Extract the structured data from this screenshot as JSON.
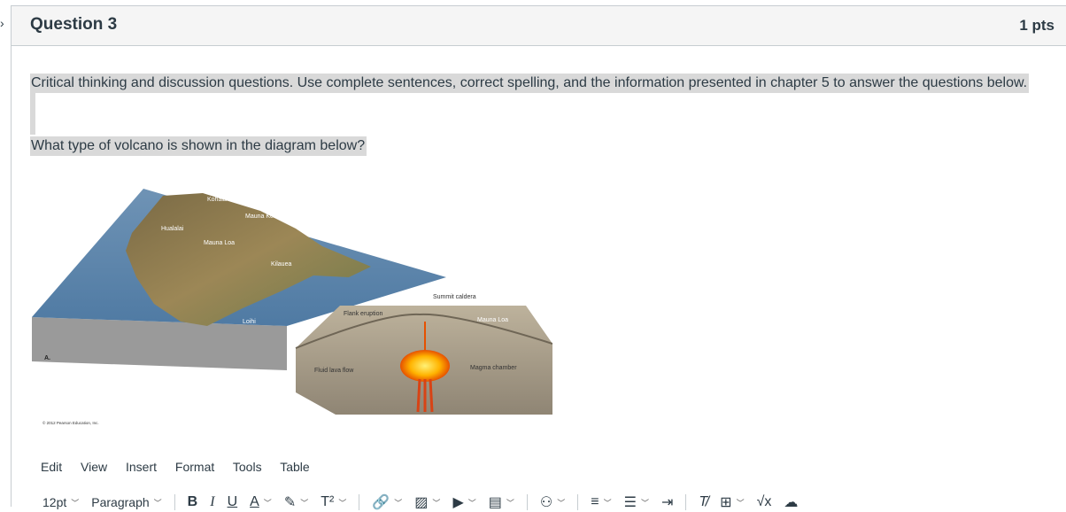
{
  "question": {
    "title": "Question 3",
    "points": "1 pts"
  },
  "body": {
    "instructions": "Critical thinking and discussion questions. Use complete sentences, correct spelling, and the information presented in chapter 5 to answer the questions below.",
    "prompt": "What type of volcano is shown in the diagram below?"
  },
  "diagram": {
    "labels": {
      "kohala": "Kohala",
      "mauna_kea": "Mauna Kea",
      "hualalai": "Hualalai",
      "hawaii": "HAWAII",
      "mauna_loa": "Mauna Loa",
      "kilauea": "Kilauea",
      "loihi": "Loihi",
      "summit_caldera": "Summit caldera",
      "flank_eruption": "Flank eruption",
      "mauna_loa_cross": "Mauna Loa",
      "fluid_lava_flow": "Fluid lava flow",
      "magma_chamber": "Magma chamber",
      "panel": "A.",
      "copyright": "© 2012 Pearson Education, Inc."
    }
  },
  "editor": {
    "menu": [
      "Edit",
      "View",
      "Insert",
      "Format",
      "Tools",
      "Table"
    ],
    "font_size": "12pt",
    "block_format": "Paragraph",
    "superscript_label": "T²"
  }
}
